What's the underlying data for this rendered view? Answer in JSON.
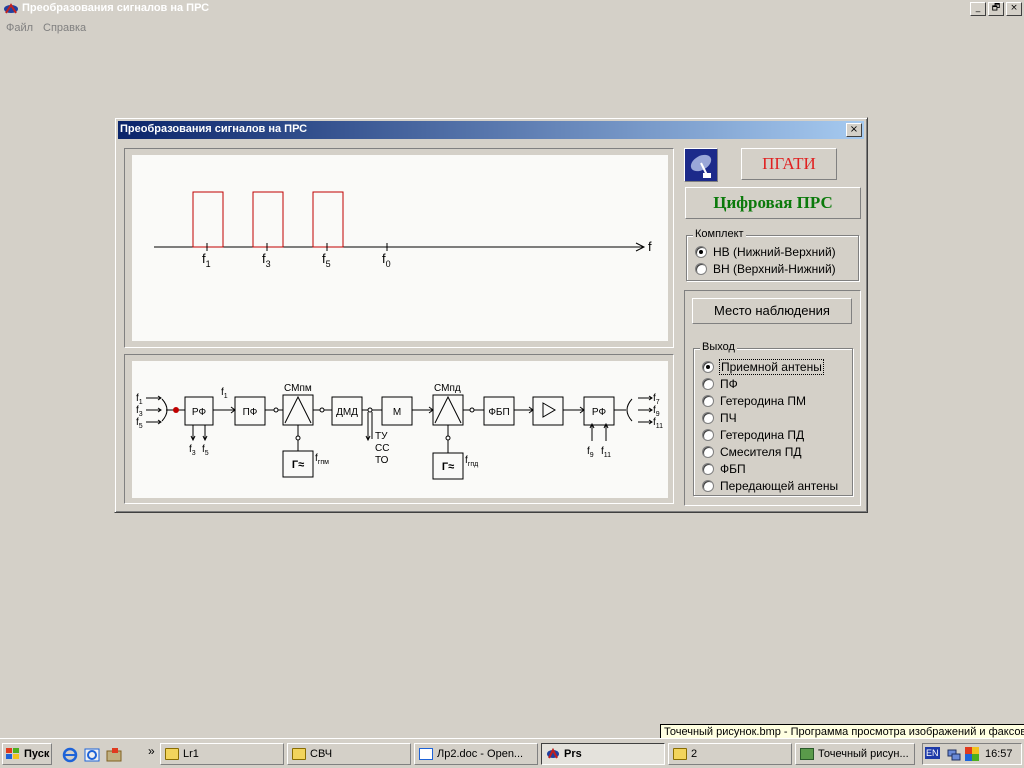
{
  "app": {
    "title": "Преобразования сигналов на ПРС",
    "menu": [
      "Файл",
      "Справка"
    ],
    "window_buttons": [
      "_",
      "🗗",
      "×"
    ]
  },
  "dialog": {
    "title": "Преобразования сигналов на ПРС",
    "close": "×"
  },
  "spectrum": {
    "axis_label": "f",
    "ticks": [
      {
        "base": "f",
        "sub": "1"
      },
      {
        "base": "f",
        "sub": "3"
      },
      {
        "base": "f",
        "sub": "5"
      },
      {
        "base": "f",
        "sub": "0"
      }
    ],
    "bars_color": "#c00000"
  },
  "diagram": {
    "inputs": [
      {
        "base": "f",
        "sub": "1"
      },
      {
        "base": "f",
        "sub": "3"
      },
      {
        "base": "f",
        "sub": "5"
      }
    ],
    "outputs": [
      {
        "base": "f",
        "sub": "7"
      },
      {
        "base": "f",
        "sub": "9"
      },
      {
        "base": "f",
        "sub": "11"
      }
    ],
    "blocks": [
      "РФ",
      "ПФ",
      "ДМД",
      "М",
      "ФБП",
      "РФ"
    ],
    "mixer1_label": "СМпм",
    "mixer2_label": "СМпд",
    "gen_symbol": "Г≈",
    "gen1_label": {
      "base": "f",
      "sub": "гпм"
    },
    "gen2_label": {
      "base": "f",
      "sub": "гпд"
    },
    "rf_in_out": [
      {
        "base": "f",
        "sub": "3"
      },
      {
        "base": "f",
        "sub": "5"
      }
    ],
    "pf_in": {
      "base": "f",
      "sub": "1"
    },
    "rf_out_in": [
      {
        "base": "f",
        "sub": "9"
      },
      {
        "base": "f",
        "sub": "11"
      }
    ],
    "service": [
      "ТУ",
      "СС",
      "ТО"
    ]
  },
  "side": {
    "logo_button": "ПГАТИ",
    "system_label": "Цифровая ПРС",
    "kit_group": {
      "legend": "Комплект",
      "options": [
        "НВ (Нижний-Верхний)",
        "ВН (Верхний-Нижний)"
      ],
      "selected": 0
    },
    "place_button": "Место наблюдения",
    "output_group": {
      "legend": "Выход",
      "options": [
        "Приемной антены",
        "ПФ",
        "Гетеродина ПМ",
        "ПЧ",
        "Гетеродина ПД",
        "Смесителя ПД",
        "ФБП",
        "Передающей антены"
      ],
      "selected": 0
    }
  },
  "colors": {
    "accent_green": "#0b7a0b",
    "accent_red": "#e02020",
    "title_blue": "#0a246a"
  },
  "taskbar": {
    "start": "Пуск",
    "buttons": [
      "Lr1",
      "СВЧ",
      "Лр2.doc - Open...",
      "Prs",
      "2",
      "Точечный рисун..."
    ],
    "active": 3,
    "clock": "16:57",
    "lang": "EN",
    "tooltip": "Точечный рисунок.bmp - Программа просмотра изображений и факсов",
    "chevron": "»"
  }
}
